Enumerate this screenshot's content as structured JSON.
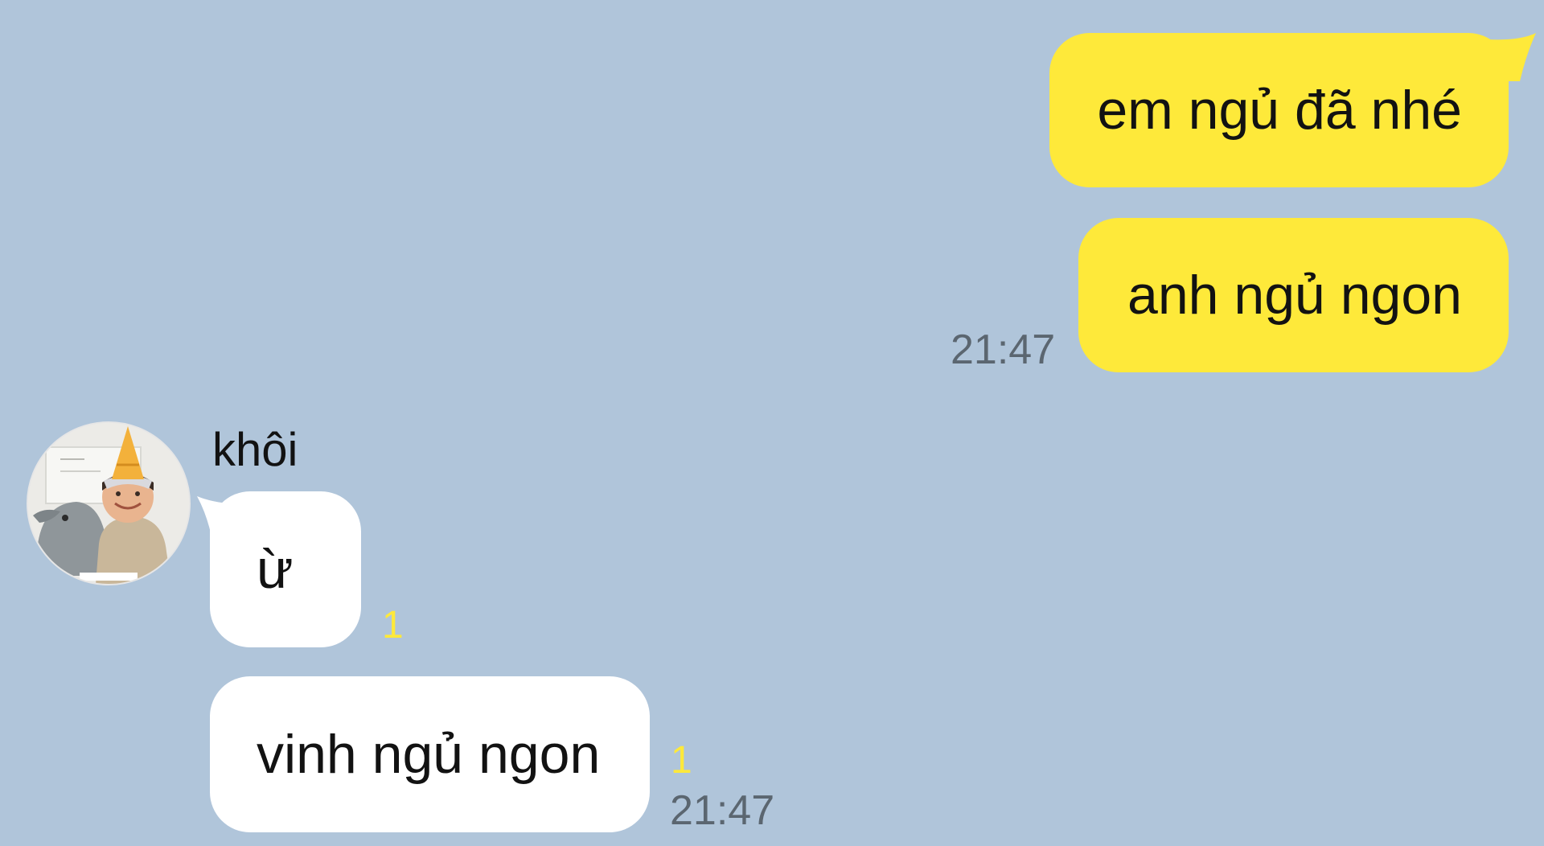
{
  "colors": {
    "background": "#b0c5da",
    "outgoing_bubble": "#fee93a",
    "incoming_bubble": "#ffffff",
    "timestamp": "#5b6670",
    "unread_count": "#fee93a"
  },
  "outgoing": {
    "messages": [
      {
        "text": "em ngủ đã nhé"
      },
      {
        "text": "anh ngủ ngon"
      }
    ],
    "time": "21:47"
  },
  "incoming": {
    "sender": "khôi",
    "avatar_icon": "profile-photo",
    "messages": [
      {
        "text": "ừ",
        "unread": "1"
      },
      {
        "text": "vinh ngủ ngon",
        "unread": "1"
      }
    ],
    "time": "21:47"
  }
}
